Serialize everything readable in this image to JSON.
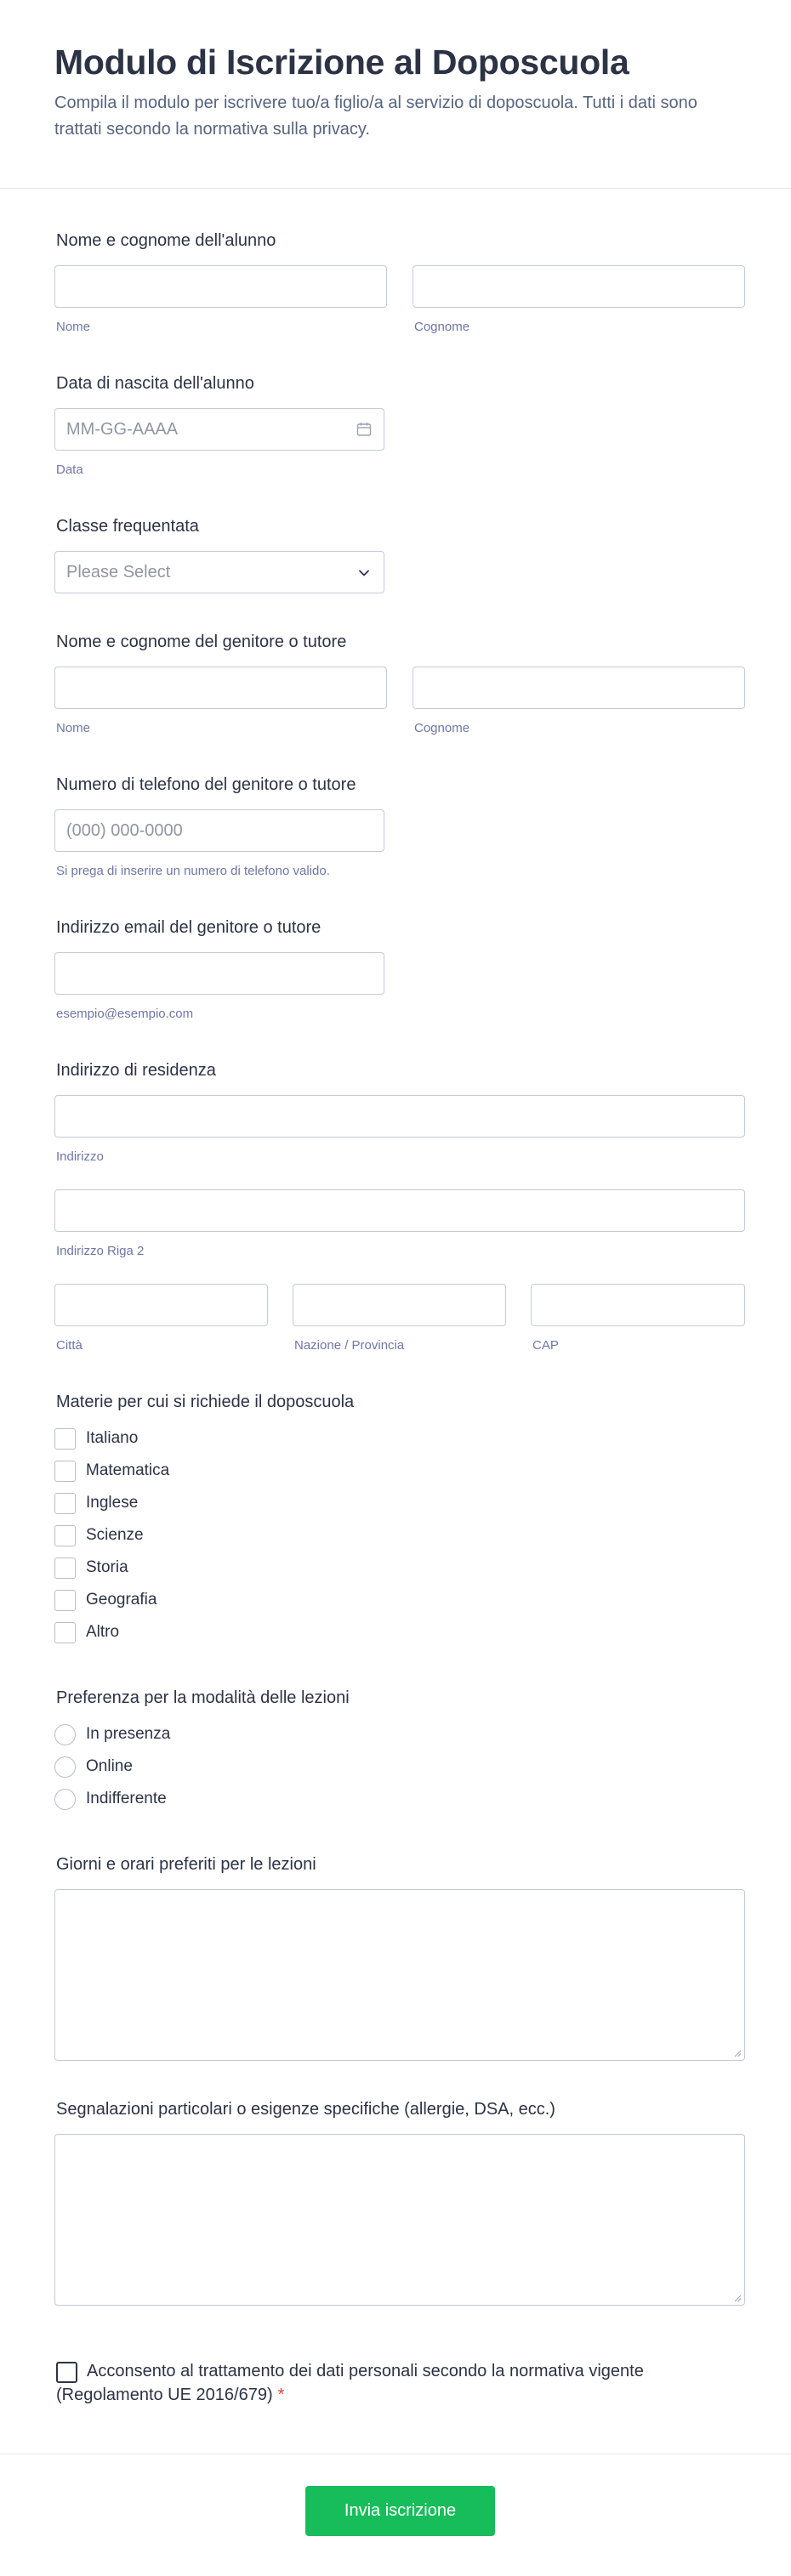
{
  "header": {
    "title": "Modulo di Iscrizione al Doposcuola",
    "subtitle": "Compila il modulo per iscrivere tuo/a figlio/a al servizio di doposcuola. Tutti i dati sono trattati secondo la normativa sulla privacy."
  },
  "student_name": {
    "label": "Nome e cognome dell'alunno",
    "first_sublabel": "Nome",
    "last_sublabel": "Cognome"
  },
  "birth_date": {
    "label": "Data di nascita dell'alunno",
    "placeholder": "MM-GG-AAAA",
    "sublabel": "Data",
    "icon": "calendar-icon"
  },
  "class": {
    "label": "Classe frequentata",
    "placeholder": "Please Select",
    "icon": "chevron-down-icon"
  },
  "parent_name": {
    "label": "Nome e cognome del genitore o tutore",
    "first_sublabel": "Nome",
    "last_sublabel": "Cognome"
  },
  "phone": {
    "label": "Numero di telefono del genitore o tutore",
    "placeholder": "(000) 000-0000",
    "sublabel": "Si prega di inserire un numero di telefono valido."
  },
  "email": {
    "label": "Indirizzo email del genitore o tutore",
    "sublabel": "esempio@esempio.com"
  },
  "address": {
    "label": "Indirizzo di residenza",
    "line1_sublabel": "Indirizzo",
    "line2_sublabel": "Indirizzo Riga 2",
    "city_sublabel": "Città",
    "state_sublabel": "Nazione / Provincia",
    "zip_sublabel": "CAP"
  },
  "subjects": {
    "label": "Materie per cui si richiede il doposcuola",
    "options": [
      "Italiano",
      "Matematica",
      "Inglese",
      "Scienze",
      "Storia",
      "Geografia",
      "Altro"
    ]
  },
  "mode": {
    "label": "Preferenza per la modalità delle lezioni",
    "options": [
      "In presenza",
      "Online",
      "Indifferente"
    ]
  },
  "schedule": {
    "label": "Giorni e orari preferiti per le lezioni"
  },
  "notes": {
    "label": "Segnalazioni particolari o esigenze specifiche (allergie, DSA, ecc.)"
  },
  "consent": {
    "text": "Acconsento al trattamento dei dati personali secondo la normativa vigente (Regolamento UE 2016/679)",
    "required_mark": "*",
    "required_color": "#f23a3c"
  },
  "submit": {
    "label": "Invia iscrizione",
    "color": "#18bd5b"
  }
}
